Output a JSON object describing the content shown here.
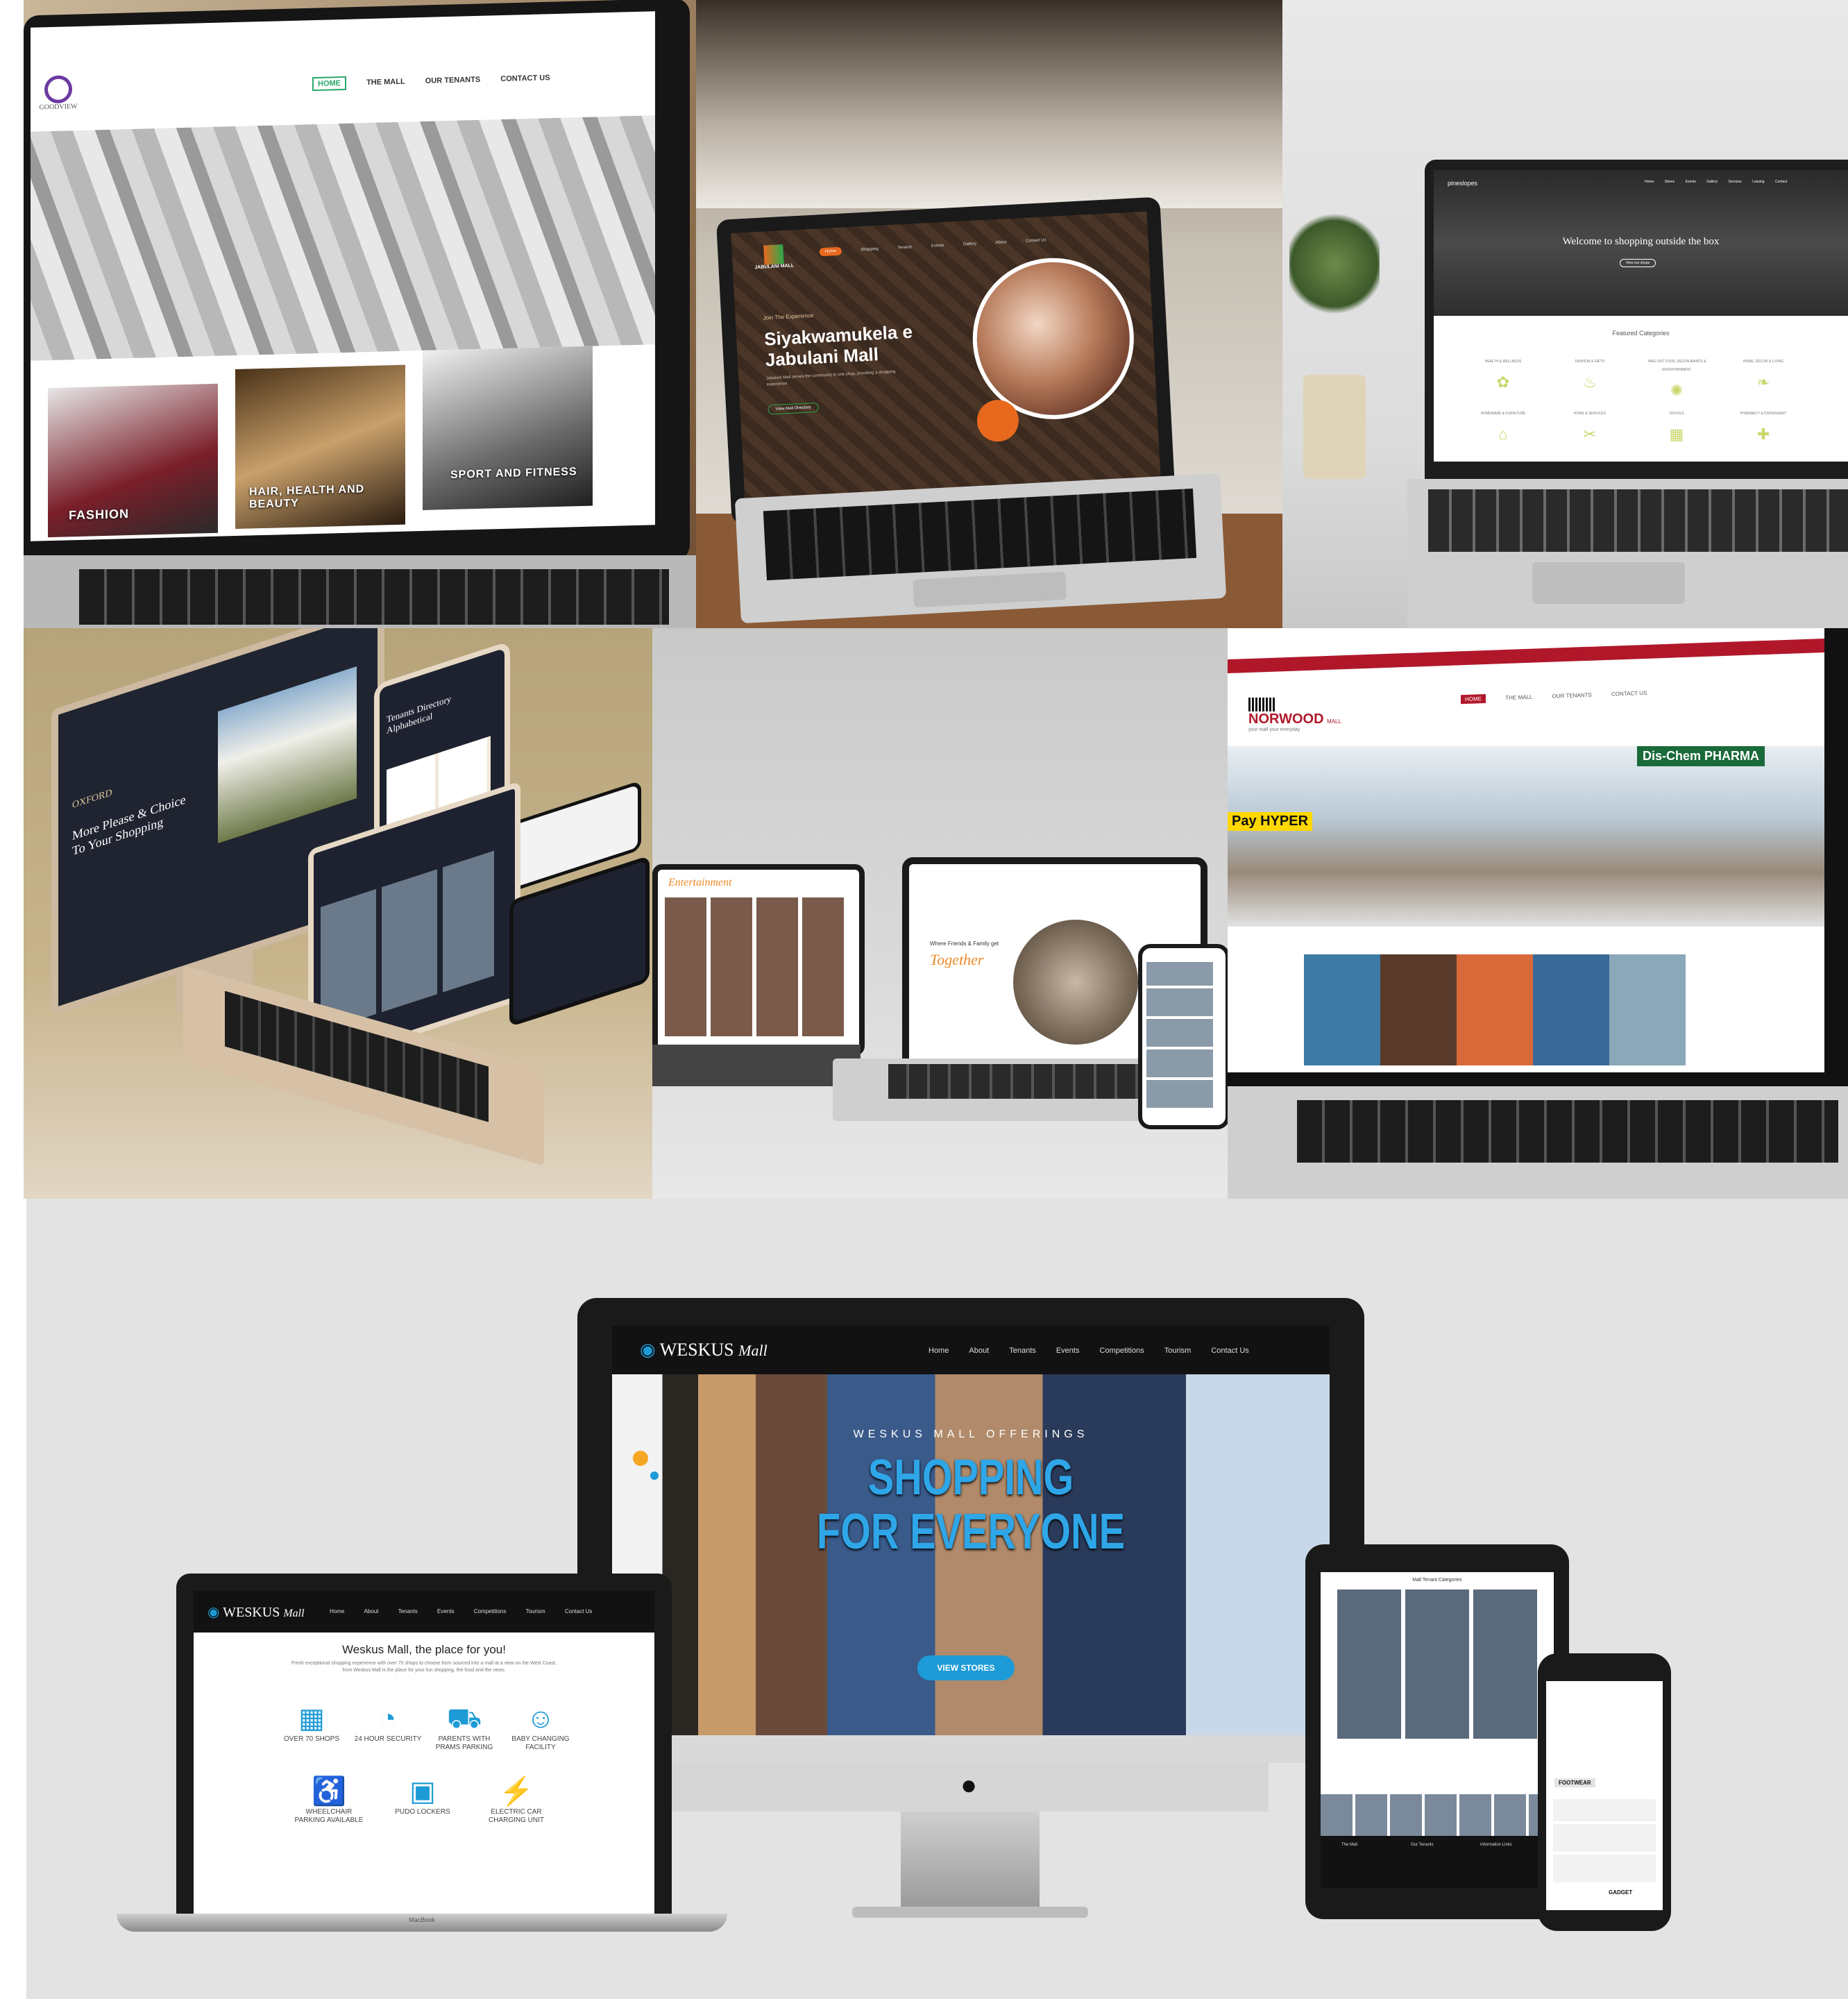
{
  "goodview": {
    "logo_text": "GOODVIEW",
    "nav": [
      "HOME",
      "THE MALL",
      "OUR TENANTS",
      "CONTACT US"
    ],
    "cards": [
      "FASHION",
      "HAIR, HEALTH AND BEAUTY",
      "SPORT AND FITNESS"
    ]
  },
  "jabulani": {
    "logo_text": "JABULANI MALL",
    "nav": [
      "Home",
      "Shopping",
      "Tenants",
      "Events",
      "Gallery",
      "About",
      "Contact Us"
    ],
    "kicker": "Join The Experience",
    "heading_line1": "Siyakwamukela e",
    "heading_line2": "Jabulani Mall",
    "body": "Jabulani Mall serves the community in one shop, providing a shopping experience.",
    "cta": "View Mall Directory"
  },
  "shopping_outside": {
    "logo_text": "pineslopes",
    "nav": [
      "Home",
      "Stores",
      "Events",
      "Gallery",
      "Services",
      "Leasing",
      "Contact"
    ],
    "hero_title": "Welcome to shopping outside the box",
    "hero_button": "View our shops",
    "section_title": "Featured Categories",
    "categories": [
      "Health & Wellness",
      "Fashion & Gifts",
      "Take Out Food, Restaurants & Entertainment",
      "Home, Décor & Living",
      "Homeware & Furniture",
      "Home & Services",
      "Offices",
      "Pharmacy & Dispensary"
    ]
  },
  "oxford": {
    "logo_text": "OXFORD",
    "headline_line1": "More Please & Choice",
    "headline_line2": "To Your Shopping",
    "tablet_title": "Tenants Directory Alphabetical"
  },
  "together": {
    "tablet_title": "Entertainment",
    "laptop_kicker": "Where Friends & Family get",
    "laptop_title": "Together"
  },
  "norwood": {
    "logo_text": "NORWOOD",
    "logo_sub": "MALL",
    "tagline": "your mall your everyday",
    "nav": [
      "HOME",
      "THE MALL",
      "OUR TENANTS",
      "CONTACT US"
    ],
    "store_signs": [
      "Pay HYPER",
      "Dis-Chem PHARMA"
    ]
  },
  "weskus": {
    "logo_text": "WESKUS",
    "logo_script": "Mall",
    "nav": [
      "Home",
      "About",
      "Tenants",
      "Events",
      "Competitions",
      "Tourism",
      "Contact Us"
    ],
    "hero_kicker": "WESKUS MALL OFFERINGS",
    "hero_line1": "SHOPPING",
    "hero_line2": "FOR EVERYONE",
    "hero_button": "VIEW STORES",
    "laptop_title": "Weskus Mall, the place for you!",
    "laptop_body": "Fresh exceptional shopping experience with over 70 shops to choose from sourced into a mall at a view on the West Coast, from Weskus Mall is the place for your fun shopping, the food and the news.",
    "amenities": [
      {
        "icon": "store-icon",
        "label": "OVER 70 SHOPS"
      },
      {
        "icon": "security-icon",
        "label": "24 HOUR SECURITY"
      },
      {
        "icon": "stroller-icon",
        "label": "PARENTS WITH PRAMS PARKING"
      },
      {
        "icon": "baby-icon",
        "label": "BABY CHANGING FACILITY"
      },
      {
        "icon": "wheelchair-icon",
        "label": "WHEELCHAIR PARKING AVAILABLE"
      },
      {
        "icon": "locker-icon",
        "label": "PUDO LOCKERS"
      },
      {
        "icon": "ev-charging-icon",
        "label": "ELECTRIC CAR CHARGING UNIT"
      }
    ],
    "laptop_brand": "MacBook",
    "tablet_title": "Mall Tenant Categories",
    "tablet_sections": [
      "The Mall",
      "Our Tenants",
      "Information Links"
    ],
    "phone_items": [
      "FOOTWEAR",
      "GADGET"
    ]
  }
}
